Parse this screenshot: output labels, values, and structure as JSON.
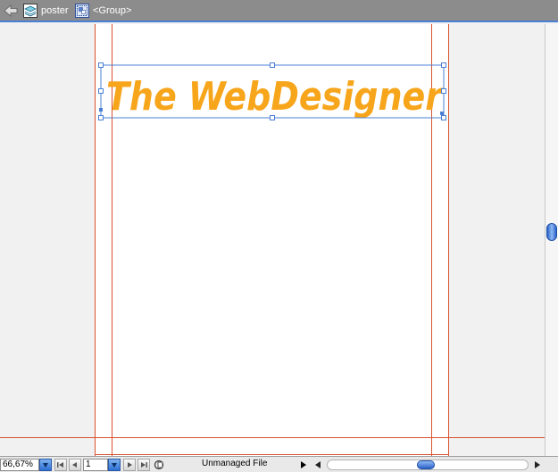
{
  "breadcrumb": {
    "layer_label": "poster",
    "group_label": "<Group>"
  },
  "artboard": {
    "headline": "The WebDesigner",
    "headline_color": "#f7a51b"
  },
  "statusbar": {
    "zoom_value": "66,67%",
    "page_value": "1",
    "file_status": "Unmanaged File"
  },
  "icons": {
    "back": "arrow-left-icon",
    "layer": "layer-icon",
    "group": "group-icon",
    "first_page": "first-page-icon",
    "prev_page": "previous-page-icon",
    "next_page": "next-page-icon",
    "last_page": "last-page-icon",
    "version_cue": "version-cue-icon",
    "play": "play-icon"
  },
  "colors": {
    "guide": "#d9532e",
    "selection": "#4a7fd4",
    "accent": "#2b62c8"
  }
}
